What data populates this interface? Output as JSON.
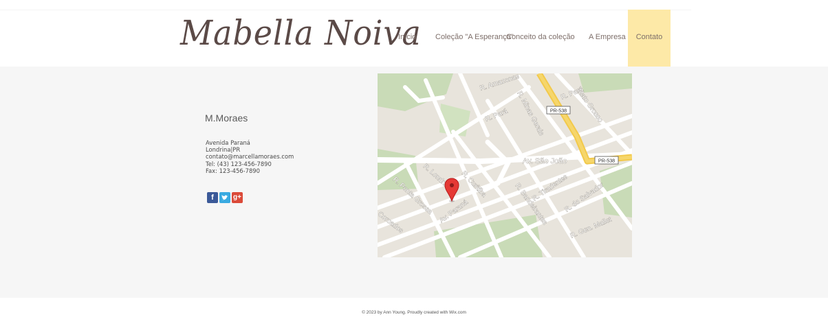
{
  "header": {
    "logo": "Mabella Noiva",
    "nav": [
      "Início",
      "Coleção \"A Esperança\"",
      "Conceito da coleção",
      "A Empresa",
      "Contato"
    ]
  },
  "contact": {
    "company": "M.Moraes",
    "address_lines": [
      "Avenida Paraná",
      "Londrina|PR",
      "contato@marcellamoraes.com",
      "Tel: (43) 123-456-7890",
      "Fax: 123-456-7890"
    ],
    "social": [
      "facebook-icon",
      "twitter-icon",
      "google-plus-icon"
    ]
  },
  "map": {
    "labels": [
      "R. Amazonas",
      "R. Pará",
      "Mato Grosso",
      "PR-538",
      "R. Minas Gerais",
      "R. Pará",
      "Av. São João",
      "PR-538",
      "R. Londrina",
      "R. Curitiba",
      "R. Ponta Grossa",
      "Av. Paraná",
      "R. Bandeirantes",
      "R. Tiradentes",
      "R. do Salvador",
      "R. Gen. Mallet",
      "Coroados"
    ],
    "marker": "map-pin-icon"
  },
  "footer": {
    "text": "© 2023 by Ann Young. Proudly created with Wix.com"
  }
}
